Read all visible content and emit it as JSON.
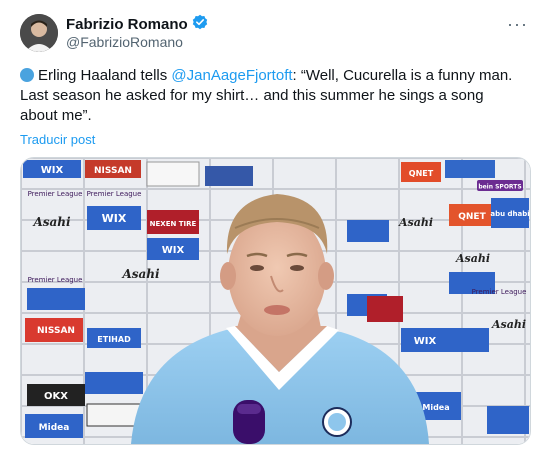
{
  "author": {
    "name": "Fabrizio Romano",
    "handle": "@FabrizioRomano"
  },
  "tweet": {
    "text_before": "Erling Haaland tells ",
    "mention": "@JanAageFjortoft",
    "text_after": ": “Well, Cucurella is a funny man. Last season he asked for my shirt… and this summer he sings a song about me”.",
    "translate_label": "Traducir post"
  },
  "menu": {
    "more_label": "···"
  },
  "media": {
    "sponsor_words": [
      "WIX",
      "NISSAN",
      "Asahi",
      "ETIHAD",
      "OKX",
      "NEXEN TIRE",
      "QNET",
      "Midea",
      "Premier League",
      "abu dhabi"
    ],
    "badge_text": "bein SPORTS"
  },
  "colors": {
    "accent": "#1d9bf0",
    "verified": "#1d9bf0",
    "shirt": "#8ec6ec"
  }
}
